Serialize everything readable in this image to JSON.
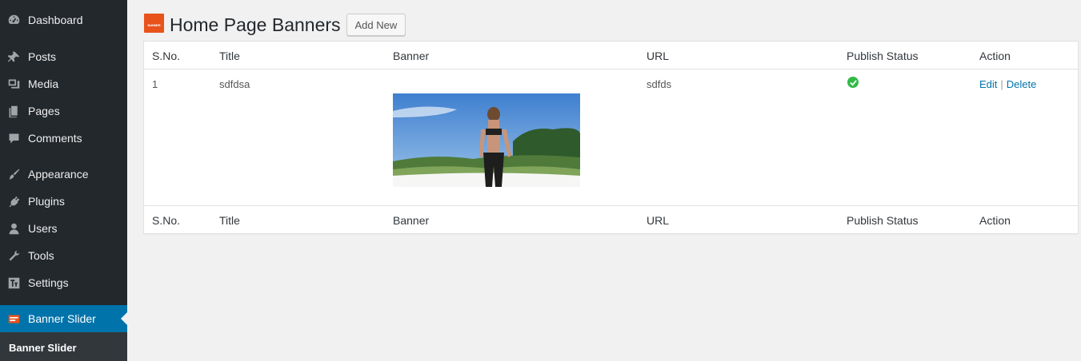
{
  "sidebar": {
    "items": [
      {
        "label": "Dashboard",
        "icon": "dashboard-icon"
      },
      {
        "label": "Posts",
        "icon": "pin-icon"
      },
      {
        "label": "Media",
        "icon": "media-icon"
      },
      {
        "label": "Pages",
        "icon": "pages-icon"
      },
      {
        "label": "Comments",
        "icon": "comment-icon"
      },
      {
        "label": "Appearance",
        "icon": "paintbrush-icon"
      },
      {
        "label": "Plugins",
        "icon": "plugin-icon"
      },
      {
        "label": "Users",
        "icon": "user-icon"
      },
      {
        "label": "Tools",
        "icon": "wrench-icon"
      },
      {
        "label": "Settings",
        "icon": "settings-icon"
      },
      {
        "label": "Banner Slider",
        "icon": "banner-slider-icon",
        "active": true
      }
    ],
    "submenu": {
      "label": "Banner Slider"
    }
  },
  "header": {
    "title": "Home Page Banners",
    "add_new_label": "Add New",
    "logo_text": "BANNER"
  },
  "table": {
    "columns": [
      "S.No.",
      "Title",
      "Banner",
      "URL",
      "Publish Status",
      "Action"
    ],
    "rows": [
      {
        "sno": "1",
        "title": "sdfdsa",
        "banner": "beach-woman-image",
        "url": "sdfds",
        "status": "published",
        "edit_label": "Edit",
        "delete_label": "Delete",
        "separator": "|"
      }
    ]
  },
  "colors": {
    "sidebar_bg": "#23282d",
    "active_bg": "#0073aa",
    "link": "#0073aa",
    "status_ok": "#31b948",
    "logo": "#e8531c"
  }
}
